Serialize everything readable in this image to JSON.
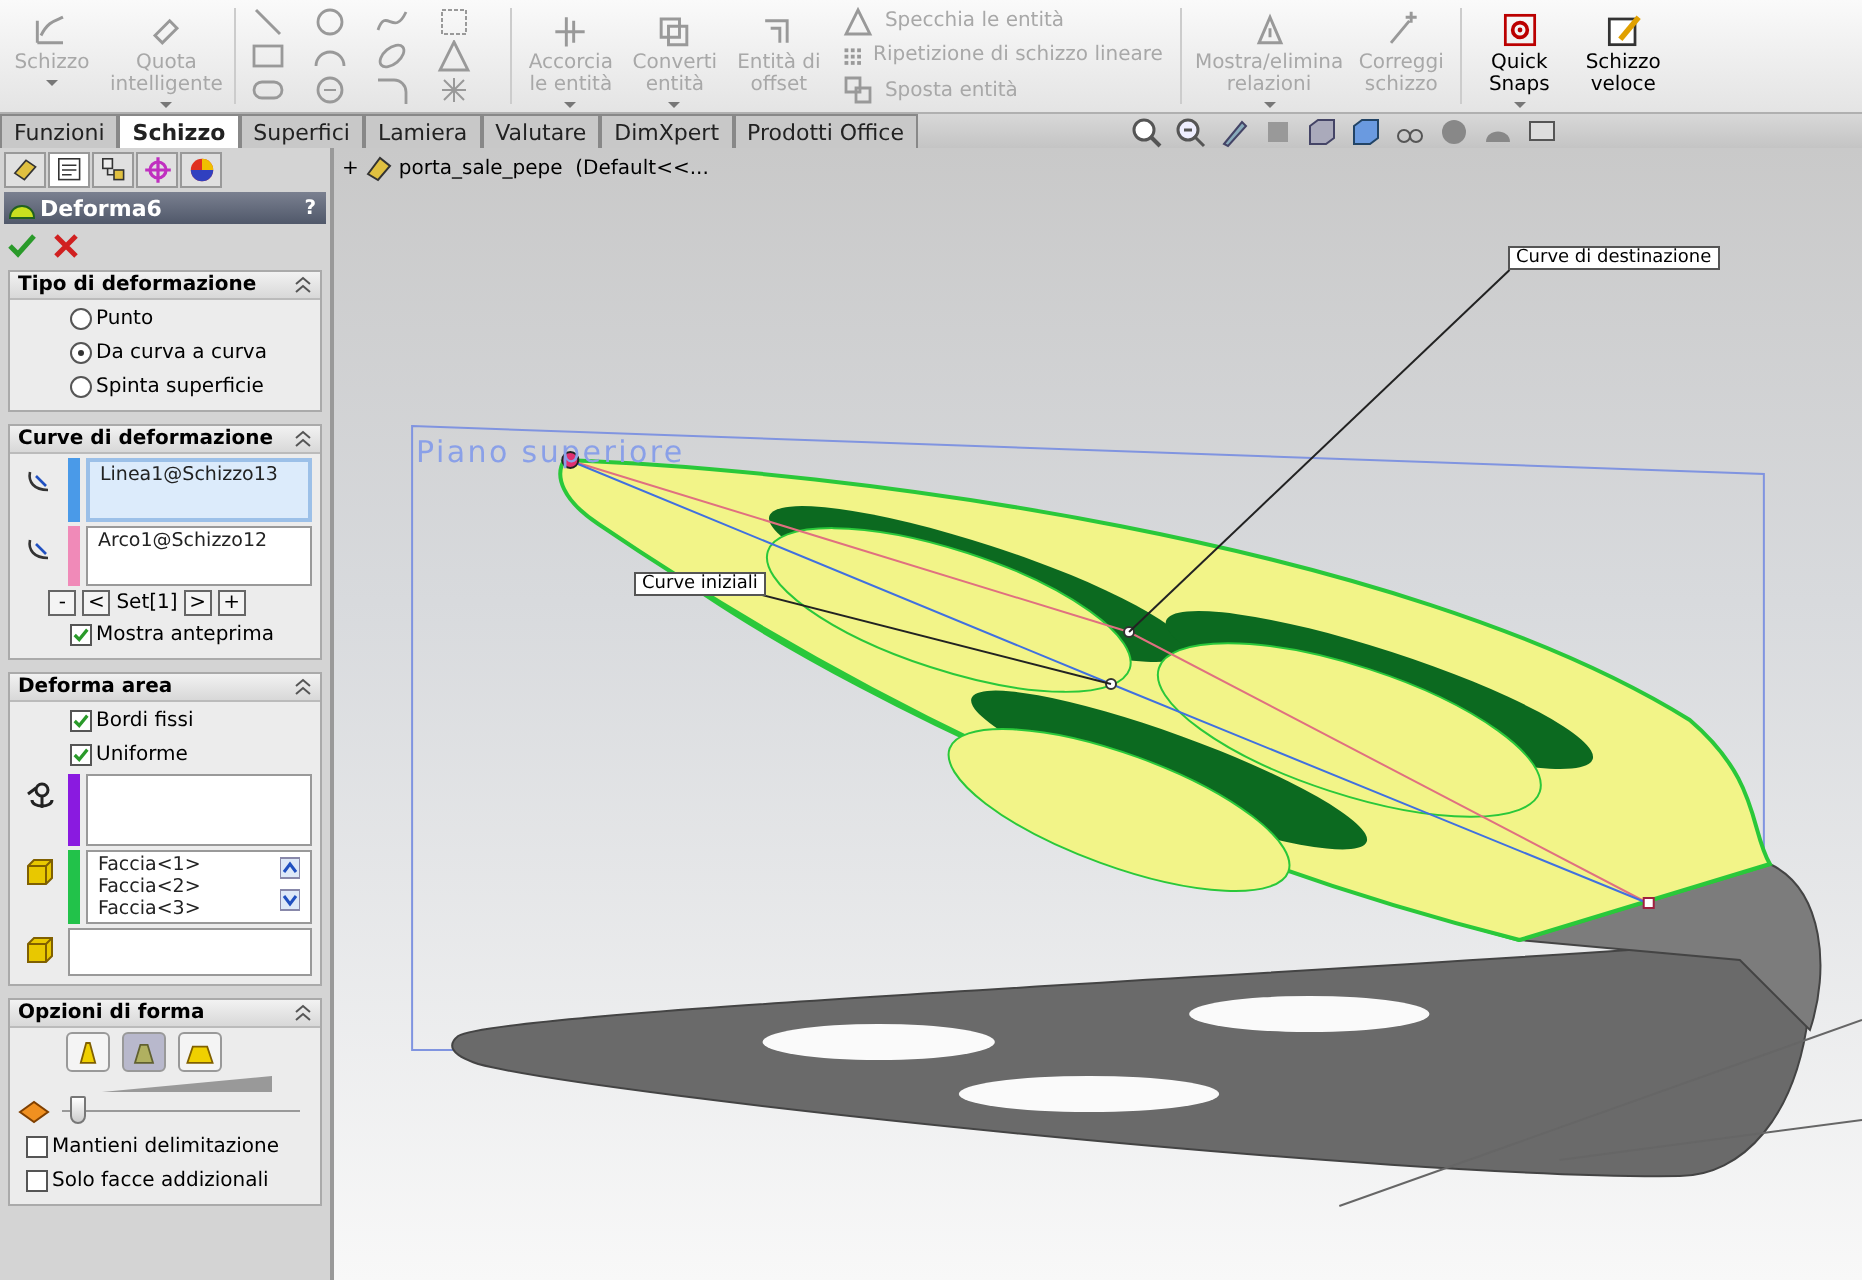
{
  "toolbar": {
    "buttons": [
      {
        "kind": "large",
        "label": "Schizzo",
        "disabled": true,
        "dropdown": true
      },
      {
        "kind": "large",
        "label": "Quota intelligente",
        "disabled": true,
        "dropdown": true
      },
      {
        "kind": "tools"
      },
      {
        "kind": "large",
        "label": "Accorcia le entità",
        "disabled": true,
        "dropdown": true
      },
      {
        "kind": "large",
        "label": "Converti entità",
        "disabled": true,
        "dropdown": true
      },
      {
        "kind": "large",
        "label": "Entità di offset",
        "disabled": true,
        "dropdown": false
      },
      {
        "kind": "list",
        "items": [
          {
            "label": "Specchia le entità",
            "disabled": true
          },
          {
            "label": "Ripetizione di schizzo lineare",
            "disabled": true
          },
          {
            "label": "Sposta entità",
            "disabled": true
          }
        ]
      },
      {
        "kind": "large",
        "label": "Mostra/elimina relazioni",
        "disabled": true,
        "dropdown": true
      },
      {
        "kind": "large",
        "label": "Correggi schizzo",
        "disabled": true,
        "dropdown": false
      },
      {
        "kind": "large",
        "label": "Quick Snaps",
        "disabled": false,
        "dropdown": true
      },
      {
        "kind": "large",
        "label": "Schizzo veloce",
        "disabled": false,
        "dropdown": false
      }
    ]
  },
  "tabs": [
    {
      "label": "Funzioni",
      "selected": false
    },
    {
      "label": "Schizzo",
      "selected": true
    },
    {
      "label": "Superfici",
      "selected": false
    },
    {
      "label": "Lamiera",
      "selected": false
    },
    {
      "label": "Valutare",
      "selected": false
    },
    {
      "label": "DimXpert",
      "selected": false
    },
    {
      "label": "Prodotti Office",
      "selected": false
    }
  ],
  "panel": {
    "tabs": [
      {
        "selected": false
      },
      {
        "selected": true
      },
      {
        "selected": false
      },
      {
        "selected": false
      },
      {
        "selected": false
      }
    ],
    "title": "Deforma6",
    "help": "?",
    "sections": [
      {
        "kind": "radios",
        "title": "Tipo di deformazione",
        "options": [
          {
            "label": "Punto",
            "selected": false
          },
          {
            "label": "Da curva a curva",
            "selected": true
          },
          {
            "label": "Spinta superficie",
            "selected": false
          }
        ]
      },
      {
        "kind": "curves",
        "title": "Curve di deformazione",
        "curves": [
          {
            "text": "Linea1@Schizzo13",
            "color": "#4a9ae8",
            "selected": true
          },
          {
            "text": "Arco1@Schizzo12",
            "color": "#f08ab8",
            "selected": false
          }
        ],
        "set_nav": {
          "before": [
            "-",
            "<"
          ],
          "label": "Set[1]",
          "after": [
            ">",
            "+"
          ]
        },
        "checkboxes": [
          {
            "label": "Mostra anteprima",
            "checked": true
          }
        ]
      },
      {
        "kind": "area",
        "title": "Deforma area",
        "checkboxes": [
          {
            "label": "Bordi fissi",
            "checked": true
          },
          {
            "label": "Uniforme",
            "checked": true
          }
        ],
        "boxes": [
          {
            "kind": "anchor",
            "color": "#8a1ae0"
          },
          {
            "kind": "faces",
            "color": "#22c24a",
            "items": [
              "Faccia<1>",
              "Faccia<2>",
              "Faccia<3>"
            ]
          },
          {
            "kind": "faces"
          }
        ]
      },
      {
        "kind": "shape",
        "title": "Opzioni di forma",
        "shapes": [
          {
            "selected": false
          },
          {
            "selected": true
          },
          {
            "selected": false
          }
        ],
        "slider": {
          "level": 0.03
        },
        "checkboxes": [
          {
            "label": "Mantieni delimitazione",
            "checked": false
          },
          {
            "label": "Solo facce addizionali",
            "checked": false
          }
        ]
      }
    ]
  },
  "viewport": {
    "tree": {
      "toggle": "+",
      "label": "porta_sale_pepe  (Default<<..."
    },
    "plane_label": "Piano superiore",
    "callouts": [
      {
        "label": "Curve di destinazione"
      },
      {
        "label": "Curve iniziali"
      }
    ]
  }
}
